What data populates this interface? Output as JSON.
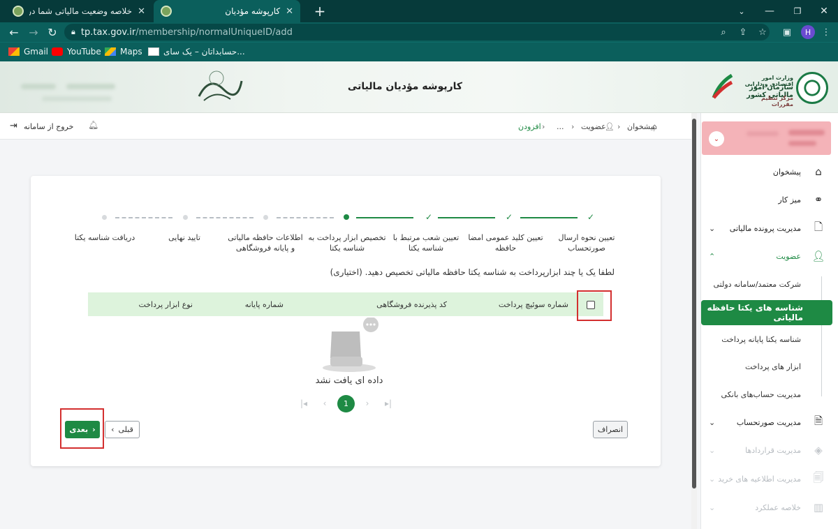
{
  "browser": {
    "tabs": [
      {
        "title": "خلاصه وضعیت مالیاتی شما در نظا",
        "active": false
      },
      {
        "title": "کارپوشه مؤدیان",
        "active": true
      }
    ],
    "url_host": "tp.tax.gov.ir",
    "url_path": "/membership/normalUniqueID/add",
    "profile_initial": "H",
    "bookmarks": [
      "Gmail",
      "YouTube",
      "Maps",
      "حسابداتان – یک سای..."
    ]
  },
  "header": {
    "title": "کارپوشه مؤدیان مالیاتی",
    "org_line1": "وزارت امور اقتصادی و دارایی",
    "org_line2": "سازمان امور مالیاتی کشور",
    "org_line3": "مرکز تنظیم مقررات"
  },
  "topbar": {
    "logout": "خروج از سامانه",
    "breadcrumb": [
      "پیشخوان",
      "عضویت",
      "...",
      "افزودن"
    ]
  },
  "stepper": {
    "steps": [
      {
        "label": "تعیین نحوه ارسال صورتحساب",
        "state": "done"
      },
      {
        "label": "تعیین کلید عمومی امضا حافظه",
        "state": "done"
      },
      {
        "label": "تعیین شعب مرتبط با شناسه یکتا",
        "state": "done"
      },
      {
        "label": "تخصیص ابزار پرداخت به شناسه یکتا",
        "state": "current"
      },
      {
        "label": "اطلاعات حافظه مالیاتی و پایانه فروشگاهی",
        "state": "todo"
      },
      {
        "label": "تایید نهایی",
        "state": "todo"
      },
      {
        "label": "دریافت شناسه یکتا",
        "state": "todo"
      }
    ]
  },
  "instruction": "لطفا یک یا چند ابزارپرداخت به شناسه یکتا حافظه مالیاتی تخصیص دهید. (اختیاری)",
  "table": {
    "columns": [
      "شماره سوئیچ پرداخت",
      "کد پذیرنده فروشگاهی",
      "شماره پایانه",
      "نوع ابزار پرداخت"
    ],
    "rows": [],
    "empty_text": "داده ای یافت نشد"
  },
  "pagination": {
    "current": "1"
  },
  "buttons": {
    "next": "بعدی",
    "prev": "قبلی",
    "cancel": "انصراف"
  },
  "sidebar": {
    "items": [
      {
        "label": "پیشخوان",
        "icon": "home-icon"
      },
      {
        "label": "میز کار",
        "icon": "workflow-icon"
      },
      {
        "label": "مدیریت پرونده مالیاتی",
        "icon": "file-icon"
      },
      {
        "label": "عضویت",
        "icon": "user-icon"
      },
      {
        "label": "مدیریت صورتحساب",
        "icon": "invoice-icon"
      },
      {
        "label": "مدیریت قراردادها",
        "icon": "contract-icon"
      },
      {
        "label": "مدیریت اطلاعیه های خرید",
        "icon": "purchase-icon"
      },
      {
        "label": "خلاصه عملکرد",
        "icon": "chart-icon"
      }
    ],
    "membership_sub": [
      "شرکت معتمد/سامانه دولتی",
      "شناسه های یکتا حافظه مالیاتی",
      "شناسه یکتا پایانه پرداخت",
      "ابزار های پرداخت",
      "مدیریت حساب‌های بانکی"
    ]
  },
  "colors": {
    "brand": "#1e8a44",
    "highlight": "#d32f2f",
    "browser": "#0b5f5c"
  }
}
